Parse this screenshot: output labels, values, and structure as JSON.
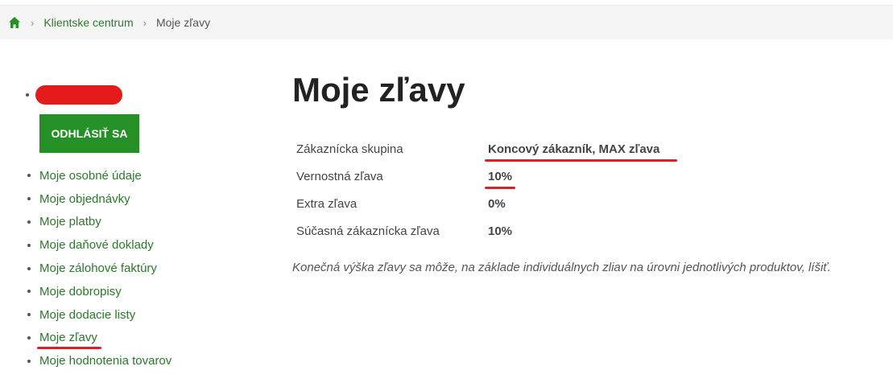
{
  "breadcrumb": {
    "home_icon": "home-icon",
    "items": [
      "Klientske centrum",
      "Moje zľavy"
    ]
  },
  "sidebar": {
    "logout_label": "ODHLÁSIŤ SA",
    "items": [
      "Moje osobné údaje",
      "Moje objednávky",
      "Moje platby",
      "Moje daňové doklady",
      "Moje zálohové faktúry",
      "Moje dobropisy",
      "Moje dodacie listy",
      "Moje zľavy",
      "Moje hodnotenia tovarov"
    ]
  },
  "main": {
    "title": "Moje zľavy",
    "rows": [
      {
        "label": "Zákaznícka skupina",
        "value": "Koncový zákazník, MAX zľava"
      },
      {
        "label": "Vernostná zľava",
        "value": "10%"
      },
      {
        "label": "Extra zľava",
        "value": "0%"
      },
      {
        "label": "Súčasná zákaznícka zľava",
        "value": "10%"
      }
    ],
    "note": "Konečná výška zľavy sa môže, na základe individuálnych zliav na úrovni jednotlivých produktov, líšiť."
  },
  "colors": {
    "accent_green": "#259025",
    "link_green": "#2a7a2a",
    "annotation_red": "#e02020"
  }
}
